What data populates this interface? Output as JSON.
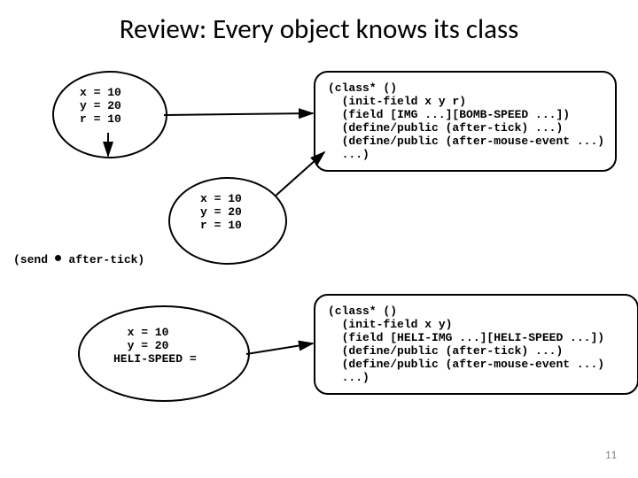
{
  "title": "Review: Every object knows its class",
  "obj1": "x = 10\ny = 20\nr = 10",
  "obj2": "x = 10\ny = 20\nr = 10",
  "obj3": "  x = 10\n  y = 20\nHELI-SPEED =",
  "class1": "(class* ()\n  (init-field x y r)\n  (field [IMG ...][BOMB-SPEED ...])\n  (define/public (after-tick) ...)\n  (define/public (after-mouse-event ...)\n  ...)",
  "class2": "(class* ()\n  (init-field x y)\n  (field [HELI-IMG ...][HELI-SPEED ...])\n  (define/public (after-tick) ...)\n  (define/public (after-mouse-event ...)\n  ...)",
  "send": "(send   after-tick)",
  "pagenum": "11"
}
